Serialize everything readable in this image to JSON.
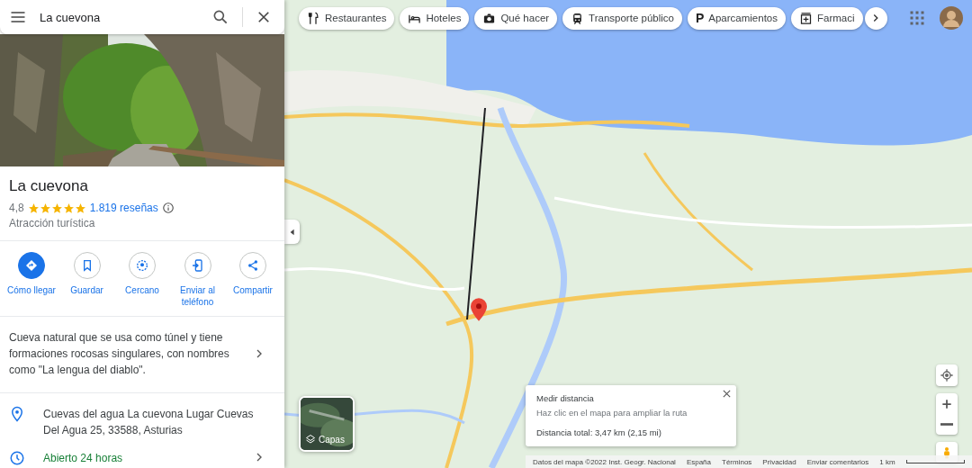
{
  "search": {
    "value": "La cuevona"
  },
  "place": {
    "name": "La cuevona",
    "rating": "4,8",
    "stars": 5,
    "reviews": "1.819 reseñas",
    "category": "Atracción turística"
  },
  "actions": [
    {
      "label": "Cómo llegar",
      "kind": "directions",
      "primary": true
    },
    {
      "label": "Guardar",
      "kind": "save",
      "primary": false
    },
    {
      "label": "Cercano",
      "kind": "nearby",
      "primary": false
    },
    {
      "label": "Enviar al teléfono",
      "kind": "phone",
      "primary": false
    },
    {
      "label": "Compartir",
      "kind": "share",
      "primary": false
    }
  ],
  "description": "Cueva natural que se usa como túnel y tiene formaciones rocosas singulares, con nombres como \"La lengua del diablo\".",
  "details": [
    {
      "kind": "address",
      "text": "Cuevas del agua La cuevona Lugar Cuevas Del Agua 25, 33588, Asturias",
      "open": false
    },
    {
      "kind": "hours",
      "text": "Abierto 24 horas",
      "open": true
    }
  ],
  "chips": [
    {
      "label": "Restaurantes",
      "kind": "restaurant"
    },
    {
      "label": "Hoteles",
      "kind": "hotel"
    },
    {
      "label": "Qué hacer",
      "kind": "camera"
    },
    {
      "label": "Transporte público",
      "kind": "transit"
    },
    {
      "label": "Aparcamientos",
      "kind": "parking",
      "icon": "P"
    },
    {
      "label": "Farmaci",
      "kind": "pharmacy"
    }
  ],
  "layers": {
    "label": "Capas"
  },
  "measure": {
    "title": "Medir distancia",
    "hint": "Haz clic en el mapa para ampliar la ruta",
    "total": "Distancia total: 3,47 km (2,15 mi)"
  },
  "footer": [
    "Datos del mapa ©2022 Inst. Geogr. Nacional",
    "España",
    "Términos",
    "Privacidad",
    "Enviar comentarios"
  ],
  "scale": "1 km"
}
